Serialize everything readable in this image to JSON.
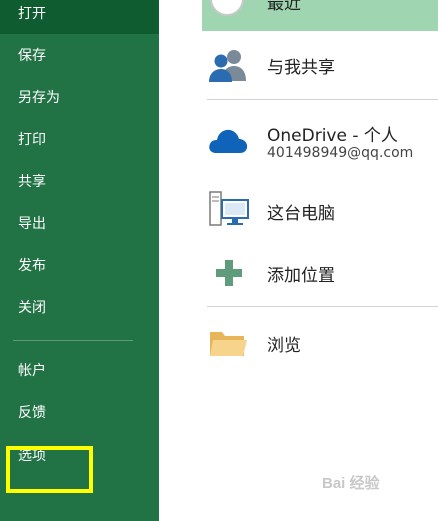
{
  "sidebar": {
    "items": [
      {
        "id": "open",
        "label": "打开"
      },
      {
        "id": "save",
        "label": "保存"
      },
      {
        "id": "save-as",
        "label": "另存为"
      },
      {
        "id": "print",
        "label": "打印"
      },
      {
        "id": "share",
        "label": "共享"
      },
      {
        "id": "export",
        "label": "导出"
      },
      {
        "id": "publish",
        "label": "发布"
      },
      {
        "id": "close",
        "label": "关闭"
      },
      {
        "id": "account",
        "label": "帐户"
      },
      {
        "id": "feedback",
        "label": "反馈"
      },
      {
        "id": "options",
        "label": "选项"
      }
    ],
    "active": "open"
  },
  "locations": {
    "recent": {
      "label": "最近"
    },
    "shared": {
      "title": "与我共享",
      "icon": "people-icon"
    },
    "onedrive": {
      "title": "OneDrive - 个人",
      "subtitle": "401498949@qq.com",
      "icon": "cloud-icon"
    },
    "this_pc": {
      "title": "这台电脑",
      "icon": "computer-icon"
    },
    "add_place": {
      "title": "添加位置",
      "icon": "plus-icon"
    },
    "browse": {
      "title": "浏览",
      "icon": "folder-icon"
    }
  },
  "colors": {
    "sidebar_bg": "#217346",
    "sidebar_active": "#0e5c2f",
    "recent_highlight": "#9fd5b1",
    "highlight_box": "#ffff00"
  },
  "watermark": {
    "text": "Bai 经验"
  }
}
